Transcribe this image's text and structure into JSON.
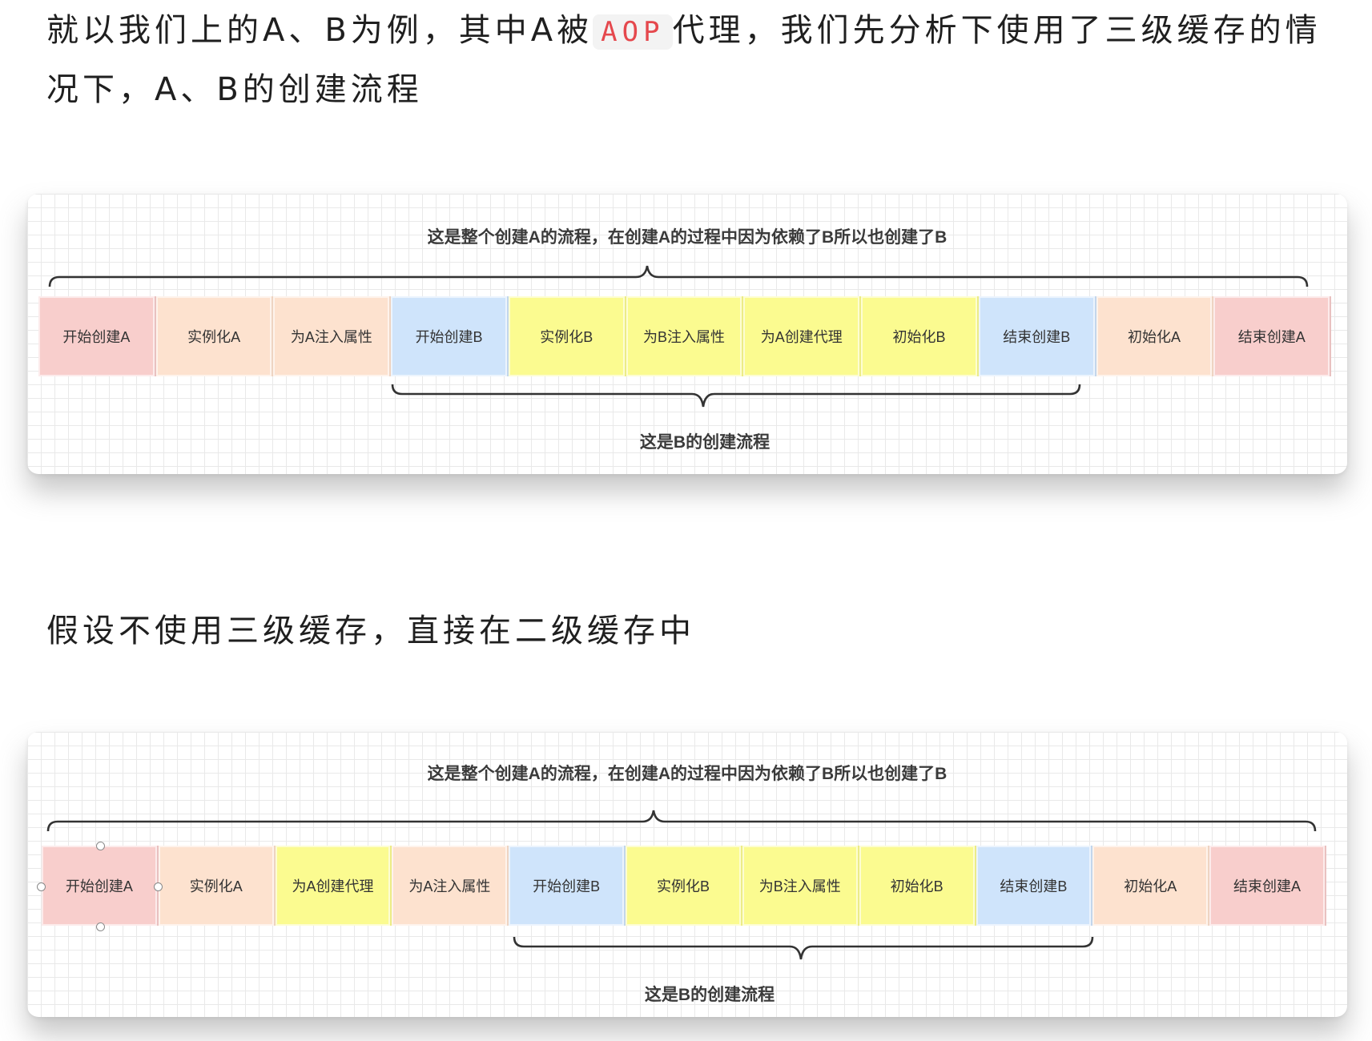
{
  "intro": {
    "part1": "就以我们上的A、B为例，其中A被",
    "code": "AOP",
    "part2": "代理，我们先分析下使用了三级缓存的情况下，A、B的创建流程"
  },
  "colors": {
    "pink": "#f8cecc",
    "peach": "#fde2cf",
    "blue": "#cfe4fb",
    "yellow": "#fbfb90"
  },
  "figure1": {
    "title": "这是整个创建A的流程，在创建A的过程中因为依赖了B所以也创建了B",
    "subtitle": "这是B的创建流程",
    "steps": [
      {
        "label": "开始创建A",
        "color": "pink"
      },
      {
        "label": "实例化A",
        "color": "peach"
      },
      {
        "label": "为A注入属性",
        "color": "peach"
      },
      {
        "label": "开始创建B",
        "color": "blue"
      },
      {
        "label": "实例化B",
        "color": "yellow"
      },
      {
        "label": "为B注入属性",
        "color": "yellow"
      },
      {
        "label": "为A创建代理",
        "color": "yellow"
      },
      {
        "label": "初始化B",
        "color": "yellow"
      },
      {
        "label": "结束创建B",
        "color": "blue"
      },
      {
        "label": "初始化A",
        "color": "peach"
      },
      {
        "label": "结束创建A",
        "color": "pink"
      }
    ]
  },
  "middle": {
    "text": "假设不使用三级缓存，直接在二级缓存中"
  },
  "figure2": {
    "title": "这是整个创建A的流程，在创建A的过程中因为依赖了B所以也创建了B",
    "subtitle": "这是B的创建流程",
    "steps": [
      {
        "label": "开始创建A",
        "color": "pink"
      },
      {
        "label": "实例化A",
        "color": "peach"
      },
      {
        "label": "为A创建代理",
        "color": "yellow"
      },
      {
        "label": "为A注入属性",
        "color": "peach"
      },
      {
        "label": "开始创建B",
        "color": "blue"
      },
      {
        "label": "实例化B",
        "color": "yellow"
      },
      {
        "label": "为B注入属性",
        "color": "yellow"
      },
      {
        "label": "初始化B",
        "color": "yellow"
      },
      {
        "label": "结束创建B",
        "color": "blue"
      },
      {
        "label": "初始化A",
        "color": "peach"
      },
      {
        "label": "结束创建A",
        "color": "pink"
      }
    ]
  }
}
